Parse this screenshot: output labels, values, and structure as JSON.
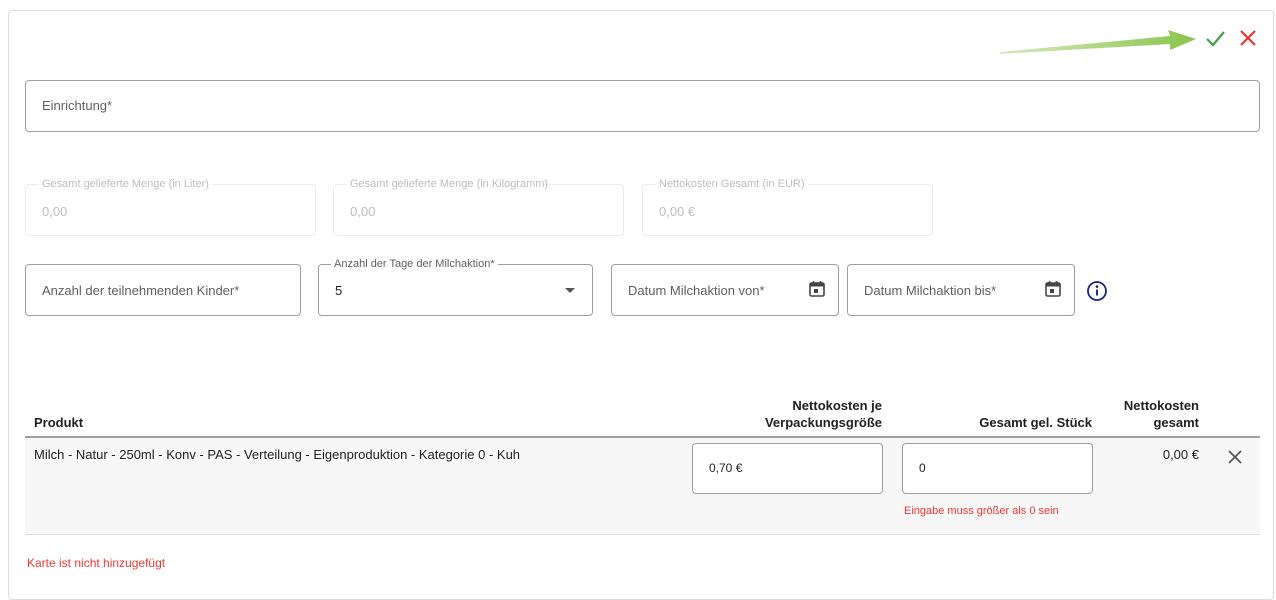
{
  "actions": {
    "confirm_icon": "checkmark-icon",
    "cancel_icon": "close-icon",
    "confirm_color": "#43a047",
    "cancel_color": "#e53935"
  },
  "form": {
    "einrichtung": {
      "label": "Einrichtung*",
      "value": ""
    },
    "totals": [
      {
        "label": "Gesamt gelieferte Menge (in Liter)",
        "value": "0,00"
      },
      {
        "label": "Gesamt gelieferte Menge (in Kilogramm)",
        "value": "0,00"
      },
      {
        "label": "Nettokosten Gesamt (in EUR)",
        "value": "0,00 €"
      }
    ],
    "kinder": {
      "label": "Anzahl der teilnehmenden Kinder*",
      "value": ""
    },
    "tage": {
      "label": "Anzahl der Tage der Milchaktion*",
      "value": "5"
    },
    "datum_von": {
      "label": "Datum Milchaktion von*"
    },
    "datum_bis": {
      "label": "Datum Milchaktion bis*"
    }
  },
  "table": {
    "headers": {
      "produkt": "Produkt",
      "netto_je_line1": "Nettokosten je",
      "netto_je_line2": "Verpackungsgröße",
      "stueck": "Gesamt gel. Stück",
      "netto_gesamt_line1": "Nettokosten",
      "netto_gesamt_line2": "gesamt"
    },
    "rows": [
      {
        "produkt": "Milch - Natur - 250ml - Konv - PAS - Verteilung - Eigenproduktion - Kategorie 0 - Kuh",
        "netto_je": "0,70 €",
        "stueck": "0",
        "stueck_error": "Eingabe muss größer als 0 sein",
        "netto_gesamt": "0,00 €"
      }
    ]
  },
  "footer_error": "Karte ist nicht hinzugefügt"
}
